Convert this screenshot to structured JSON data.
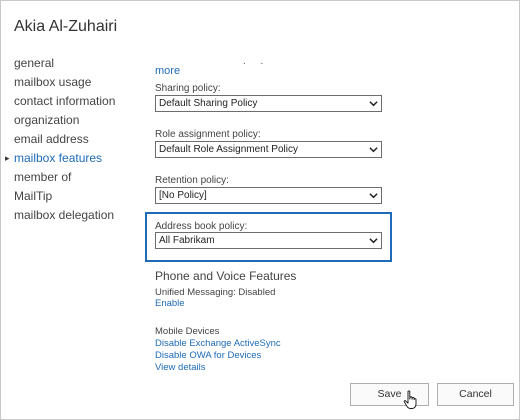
{
  "window": {
    "title": "Akia Al-Zuhairi"
  },
  "nav": {
    "items": [
      {
        "label": "general"
      },
      {
        "label": "mailbox usage"
      },
      {
        "label": "contact information"
      },
      {
        "label": "organization"
      },
      {
        "label": "email address"
      },
      {
        "label": "mailbox features",
        "selected": true
      },
      {
        "label": "member of"
      },
      {
        "label": "MailTip"
      },
      {
        "label": "mailbox delegation"
      }
    ],
    "selected_marker": "▸"
  },
  "main": {
    "more_link": "more",
    "dots": ". .",
    "sharing_policy": {
      "label": "Sharing policy:",
      "value": "Default Sharing Policy"
    },
    "role_assignment_policy": {
      "label": "Role assignment policy:",
      "value": "Default Role Assignment Policy"
    },
    "retention_policy": {
      "label": "Retention policy:",
      "value": "[No Policy]"
    },
    "address_book_policy": {
      "label": "Address book policy:",
      "value": "All Fabrikam"
    },
    "phone_voice": {
      "heading": "Phone and Voice Features",
      "unified_messaging": "Unified Messaging: Disabled",
      "enable_link": "Enable"
    },
    "mobile": {
      "heading": "Mobile Devices",
      "disable_activesync_link": "Disable Exchange ActiveSync",
      "disable_owa_link": "Disable OWA for Devices",
      "view_details_link": "View details"
    }
  },
  "footer": {
    "save_label": "Save",
    "cancel_label": "Cancel"
  },
  "colors": {
    "accent": "#1e6bb8",
    "text": "#444444",
    "border": "#6d6d6d"
  },
  "icons": {
    "dropdown": "chevron-down-icon",
    "cursor": "hand-pointer-icon"
  }
}
